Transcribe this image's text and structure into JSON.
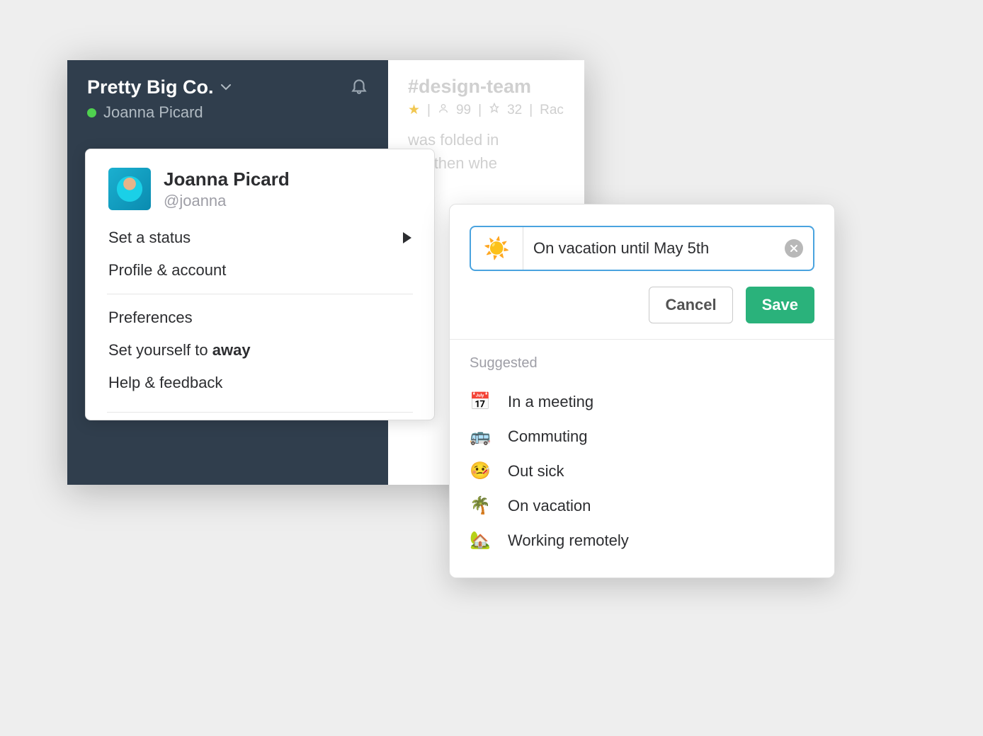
{
  "workspace": {
    "name": "Pretty Big Co.",
    "user": "Joanna Picard"
  },
  "channel": {
    "name": "#design-team",
    "members": "99",
    "pins": "32",
    "topic_tail": "Rac",
    "line1": "was folded in",
    "line2": "but then whe"
  },
  "menu": {
    "name": "Joanna Picard",
    "handle": "@joanna",
    "set_status": "Set a status",
    "profile": "Profile & account",
    "preferences": "Preferences",
    "away_prefix": "Set yourself to ",
    "away_word": "away",
    "help": "Help & feedback"
  },
  "status": {
    "emoji": "☀️",
    "value": "On vacation until May 5th",
    "cancel": "Cancel",
    "save": "Save",
    "suggested_label": "Suggested",
    "suggestions": [
      {
        "emoji": "📅",
        "label": "In a meeting"
      },
      {
        "emoji": "🚌",
        "label": "Commuting"
      },
      {
        "emoji": "🤒",
        "label": "Out sick"
      },
      {
        "emoji": "🌴",
        "label": "On vacation"
      },
      {
        "emoji": "🏡",
        "label": "Working remotely"
      }
    ]
  }
}
